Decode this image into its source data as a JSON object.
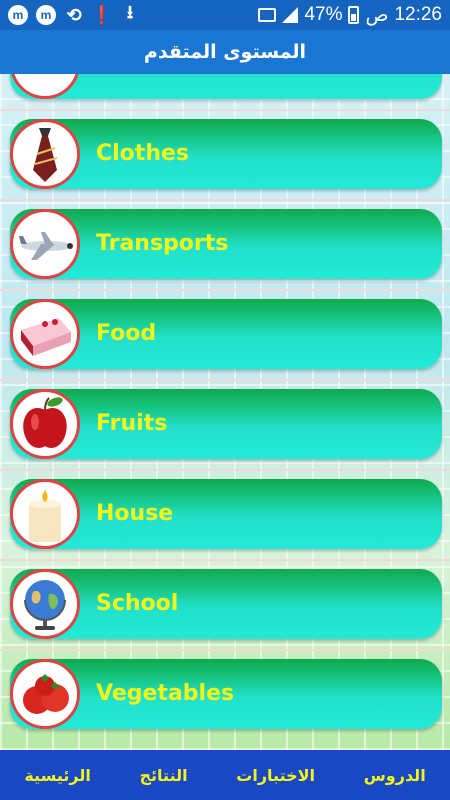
{
  "status_bar": {
    "time": "12:26",
    "am_pm": "ص",
    "battery": "47%",
    "icons": [
      "m-app-icon",
      "m-app-icon",
      "sync-icon",
      "alert-icon",
      "download-icon"
    ]
  },
  "title": "المستوى المتقدم",
  "categories": [
    {
      "label": "Clothes",
      "icon": "tie-icon"
    },
    {
      "label": "Transports",
      "icon": "airplane-icon"
    },
    {
      "label": "Food",
      "icon": "cake-icon"
    },
    {
      "label": "Fruits",
      "icon": "apple-icon"
    },
    {
      "label": "House",
      "icon": "candle-icon"
    },
    {
      "label": "School",
      "icon": "globe-icon"
    },
    {
      "label": "Vegetables",
      "icon": "tomato-icon"
    }
  ],
  "bottom_nav": {
    "lessons": "الدروس",
    "tests": "الاختبارات",
    "results": "النتائج",
    "home": "الرئيسية"
  },
  "colors": {
    "status_bar": "#1565c0",
    "title_bar": "#1976d2",
    "item_label": "#f2f51a",
    "bottom_nav": "#1a47c4"
  }
}
